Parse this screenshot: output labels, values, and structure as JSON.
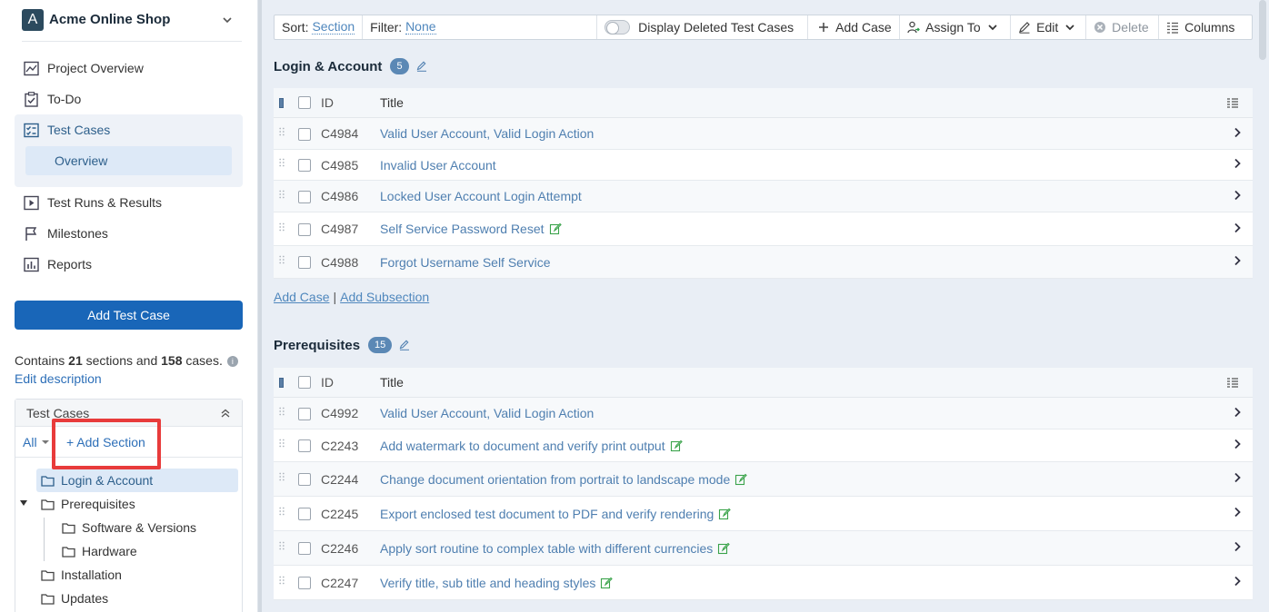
{
  "project": {
    "badge": "A",
    "name": "Acme Online Shop"
  },
  "nav": {
    "project_overview": "Project Overview",
    "todo": "To-Do",
    "test_cases": "Test Cases",
    "overview": "Overview",
    "test_runs": "Test Runs & Results",
    "milestones": "Milestones",
    "reports": "Reports"
  },
  "add_test_case": "Add Test Case",
  "summary": {
    "prefix": "Contains ",
    "sections": "21",
    "middle": " sections and ",
    "cases": "158",
    "suffix": " cases.",
    "info": "i",
    "edit_description": "Edit description"
  },
  "tree": {
    "header": "Test Cases",
    "filter_all": "All",
    "add_section": "+ Add Section",
    "nodes": [
      "Login & Account",
      "Prerequisites",
      "Software & Versions",
      "Hardware",
      "Installation",
      "Updates"
    ]
  },
  "toolbar": {
    "sort_label": "Sort:",
    "sort_value": "Section",
    "filter_label": "Filter:",
    "filter_value": "None",
    "display_deleted": "Display Deleted Test Cases",
    "add_case": "Add Case",
    "assign_to": "Assign To",
    "edit": "Edit",
    "delete": "Delete",
    "columns": "Columns"
  },
  "columns": {
    "id": "ID",
    "title": "Title"
  },
  "sections": [
    {
      "title": "Login & Account",
      "count": "5",
      "rows": [
        {
          "id": "C4984",
          "title": "Valid User Account, Valid Login Action",
          "edited": false
        },
        {
          "id": "C4985",
          "title": "Invalid User Account",
          "edited": false
        },
        {
          "id": "C4986",
          "title": "Locked User Account Login Attempt",
          "edited": false
        },
        {
          "id": "C4987",
          "title": "Self Service Password Reset",
          "edited": true
        },
        {
          "id": "C4988",
          "title": "Forgot Username Self Service",
          "edited": false
        }
      ]
    },
    {
      "title": "Prerequisites",
      "count": "15",
      "rows": [
        {
          "id": "C4992",
          "title": "Valid User Account, Valid Login Action",
          "edited": false
        },
        {
          "id": "C2243",
          "title": "Add watermark to document and verify print output",
          "edited": true
        },
        {
          "id": "C2244",
          "title": "Change document orientation from portrait to landscape mode",
          "edited": true
        },
        {
          "id": "C2245",
          "title": "Export enclosed test document to PDF and verify rendering",
          "edited": true
        },
        {
          "id": "C2246",
          "title": "Apply sort routine to complex table with different currencies",
          "edited": true
        },
        {
          "id": "C2247",
          "title": "Verify title, sub title and heading styles",
          "edited": true
        }
      ]
    }
  ],
  "section_links": {
    "add_case": "Add Case",
    "separator": "|",
    "add_subsection": "Add Subsection"
  },
  "colors": {
    "primary": "#1966b8",
    "link": "#4f7fb0",
    "highlight": "#e83b3b",
    "badge": "#5b88b5"
  }
}
